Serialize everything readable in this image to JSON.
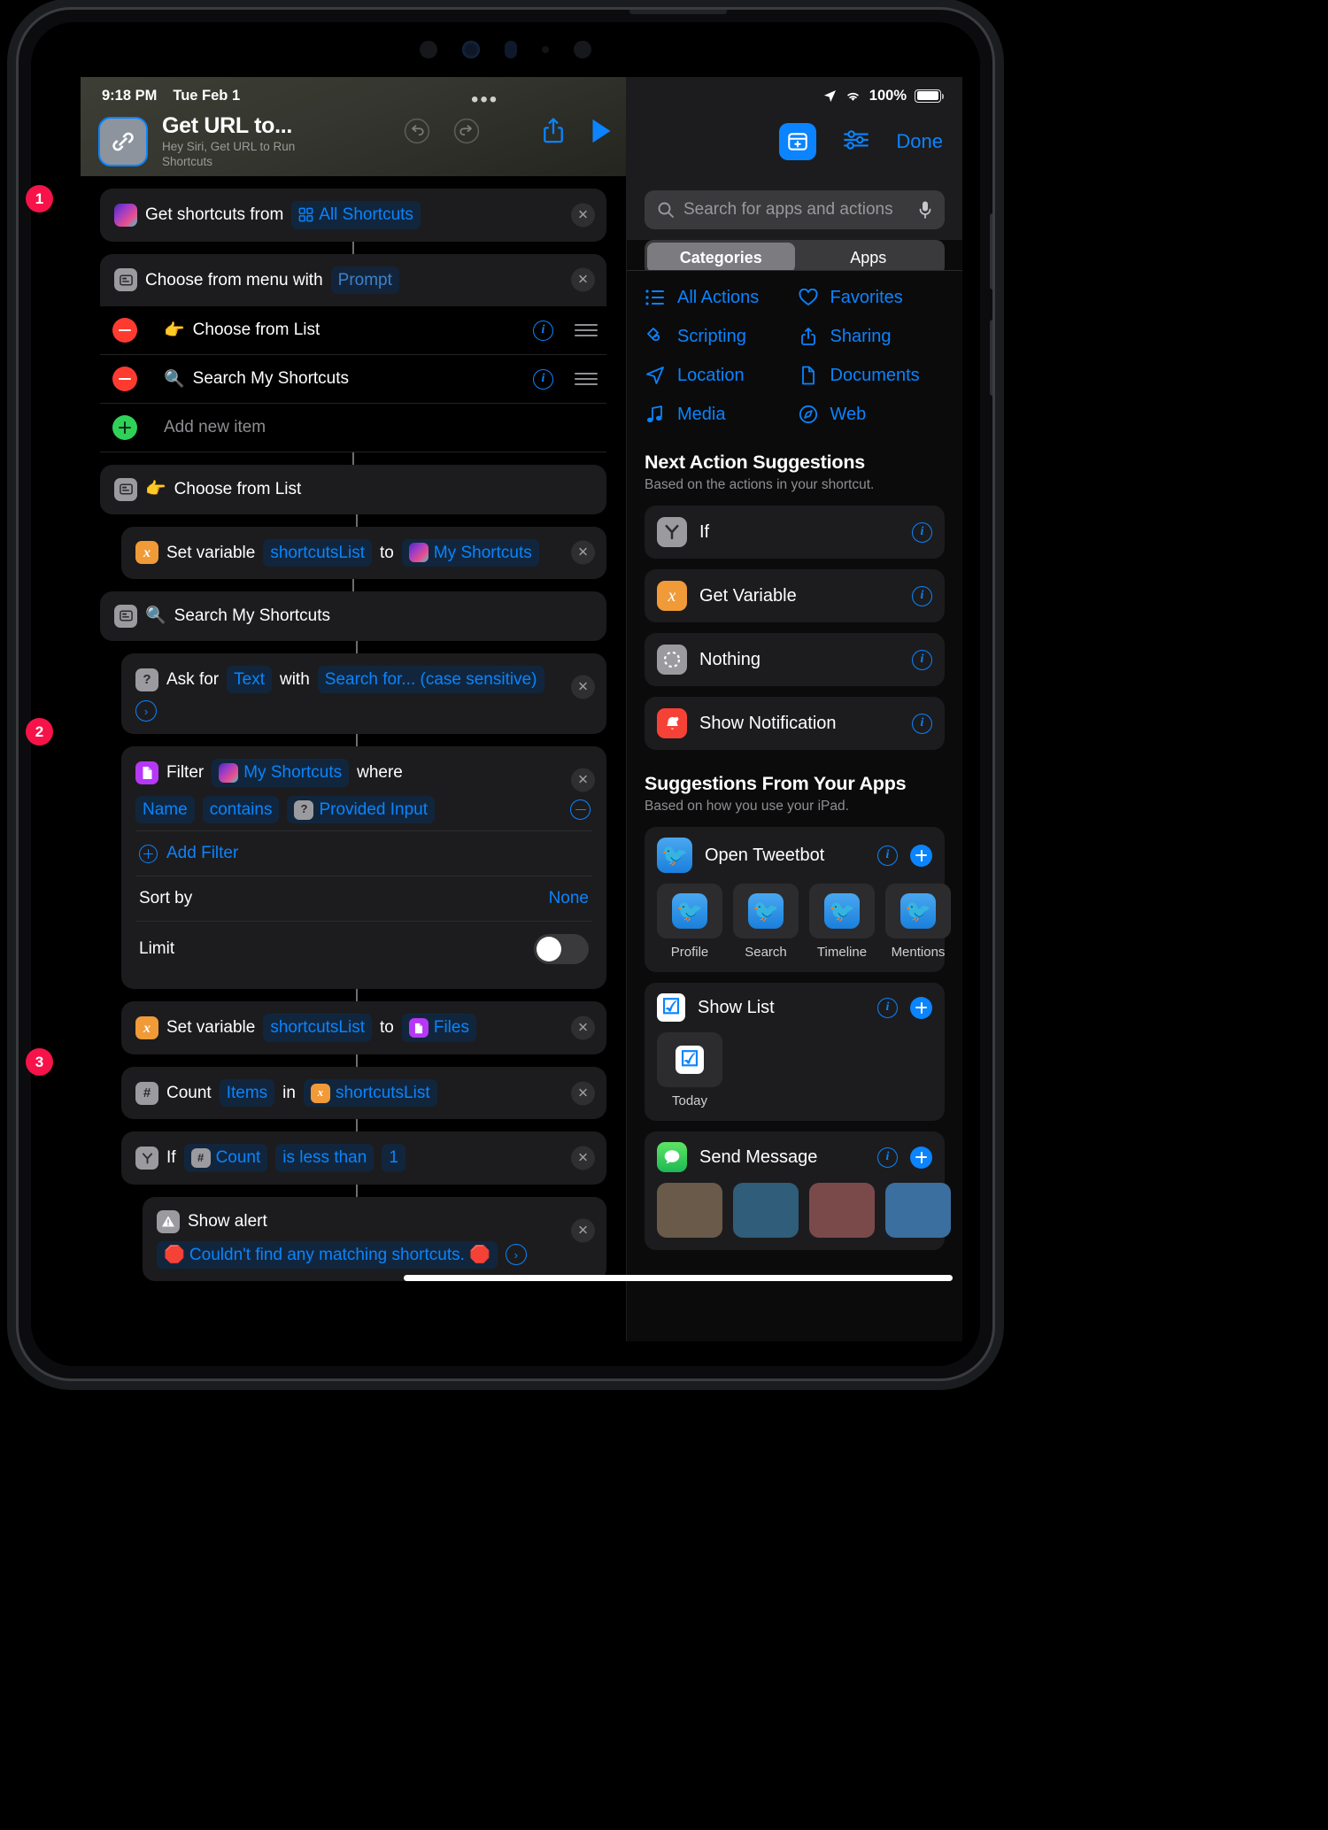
{
  "status_bar": {
    "time": "9:18 PM",
    "date": "Tue Feb 1",
    "battery_percent": "100%"
  },
  "shortcut_header": {
    "title": "Get URL to...",
    "subtitle": "Hey Siri, Get URL to Run Shortcuts",
    "icon": "link-icon",
    "undo_icon": "undo-icon",
    "redo_icon": "redo-icon",
    "share_icon": "share-icon",
    "play_icon": "play-icon",
    "menu_icon": "more-dots-icon"
  },
  "step_markers": [
    "1",
    "2",
    "3"
  ],
  "workflow": {
    "action1": {
      "icon": "shortcuts-app-icon",
      "label": "Get shortcuts from",
      "token_icon": "grid-icon",
      "token": "All Shortcuts",
      "close": "✕"
    },
    "action2": {
      "icon": "menu-icon",
      "label": "Choose from menu with",
      "placeholder_token": "Prompt",
      "close": "✕",
      "items": [
        {
          "emoji": "👉",
          "label": "Choose from List"
        },
        {
          "emoji": "🔍",
          "label": "Search My Shortcuts"
        }
      ],
      "add_new_item": "Add new item"
    },
    "action3": {
      "icon": "menu-icon",
      "emoji": "👉",
      "label": "Choose from List"
    },
    "action4": {
      "icon": "variable-icon",
      "label_a": "Set variable",
      "token_var": "shortcutsList",
      "label_b": "to",
      "token_value_icon": "shortcuts-app-icon",
      "token_value": "My Shortcuts",
      "close": "✕"
    },
    "action5": {
      "icon": "menu-icon",
      "emoji": "🔍",
      "label": "Search My Shortcuts"
    },
    "action6": {
      "icon": "ask-icon",
      "label_a": "Ask for",
      "token_type": "Text",
      "label_b": "with",
      "token_prompt": "Search for... (case sensitive)",
      "chevron": "›",
      "close": "✕"
    },
    "action7": {
      "icon": "files-icon",
      "label_a": "Filter",
      "token_source_icon": "shortcuts-app-icon",
      "token_source": "My Shortcuts",
      "label_b": "where",
      "close": "✕",
      "condition": {
        "field": "Name",
        "operator": "contains",
        "value_icon": "ask-icon",
        "value": "Provided Input",
        "remove": "minus-ring-icon"
      },
      "add_filter": "Add Filter",
      "sort_by_label": "Sort by",
      "sort_by_value": "None",
      "limit_label": "Limit",
      "limit_on": false
    },
    "action8": {
      "icon": "variable-icon",
      "label_a": "Set variable",
      "token_var": "shortcutsList",
      "label_b": "to",
      "token_value_icon": "files-icon",
      "token_value": "Files",
      "close": "✕"
    },
    "action9": {
      "icon": "count-icon",
      "label_a": "Count",
      "token_type": "Items",
      "label_b": "in",
      "token_var_icon": "variable-icon",
      "token_var": "shortcutsList",
      "close": "✕"
    },
    "action10": {
      "icon": "if-icon",
      "label_a": "If",
      "token_count_icon": "count-icon",
      "token_count": "Count",
      "token_op": "is less than",
      "token_num": "1",
      "close": "✕"
    },
    "action11": {
      "icon": "alert-icon",
      "label_a": "Show alert",
      "token_text": "🛑 Couldn't find any matching shortcuts. 🛑",
      "chevron": "›",
      "close": "✕"
    }
  },
  "right_panel": {
    "toolbar": {
      "add_action_icon": "add-action-icon",
      "settings_icon": "sliders-icon",
      "done_label": "Done"
    },
    "search": {
      "placeholder": "Search for apps and actions",
      "search_icon": "search-icon",
      "mic_icon": "microphone-icon"
    },
    "segmented": {
      "options": [
        "Categories",
        "Apps"
      ],
      "selected": "Categories"
    },
    "categories": [
      {
        "label": "All Actions",
        "icon": "list-icon"
      },
      {
        "label": "Favorites",
        "icon": "heart-icon"
      },
      {
        "label": "Scripting",
        "icon": "scripting-icon"
      },
      {
        "label": "Sharing",
        "icon": "share-up-icon"
      },
      {
        "label": "Location",
        "icon": "location-arrow-icon"
      },
      {
        "label": "Documents",
        "icon": "document-icon"
      },
      {
        "label": "Media",
        "icon": "music-note-icon"
      },
      {
        "label": "Web",
        "icon": "compass-icon"
      }
    ],
    "next_action_suggestions": {
      "title": "Next Action Suggestions",
      "subtitle": "Based on the actions in your shortcut.",
      "items": [
        {
          "label": "If",
          "icon": "if-icon",
          "info": "info-icon"
        },
        {
          "label": "Get Variable",
          "icon": "variable-icon",
          "info": "info-icon"
        },
        {
          "label": "Nothing",
          "icon": "nothing-icon",
          "info": "info-icon"
        },
        {
          "label": "Show Notification",
          "icon": "bell-icon",
          "info": "info-icon"
        }
      ]
    },
    "app_suggestions": {
      "title": "Suggestions From Your Apps",
      "subtitle": "Based on how you use your iPad.",
      "cards": [
        {
          "label": "Open Tweetbot",
          "icon": "tweetbot-icon",
          "tiles": [
            {
              "label": "Profile",
              "icon": "tweetbot-icon"
            },
            {
              "label": "Search",
              "icon": "tweetbot-icon"
            },
            {
              "label": "Timeline",
              "icon": "tweetbot-icon"
            },
            {
              "label": "Mentions",
              "icon": "tweetbot-icon"
            }
          ]
        },
        {
          "label": "Show List",
          "icon": "checkbox-icon",
          "tiles": [
            {
              "label": "Today",
              "icon": "checkbox-icon"
            }
          ]
        },
        {
          "label": "Send Message",
          "icon": "messages-icon",
          "tiles": [
            {
              "label": "",
              "icon": "avatar-icon"
            },
            {
              "label": "",
              "icon": "avatar-icon"
            },
            {
              "label": "",
              "icon": "avatar-icon"
            },
            {
              "label": "",
              "icon": "avatar-icon"
            }
          ]
        }
      ]
    }
  },
  "colors": {
    "accent_blue": "#0a84ff",
    "red": "#ff3b30",
    "green": "#30d158",
    "orange": "#f09a38",
    "purple": "#b637f5",
    "badge_red": "#f6134a"
  }
}
